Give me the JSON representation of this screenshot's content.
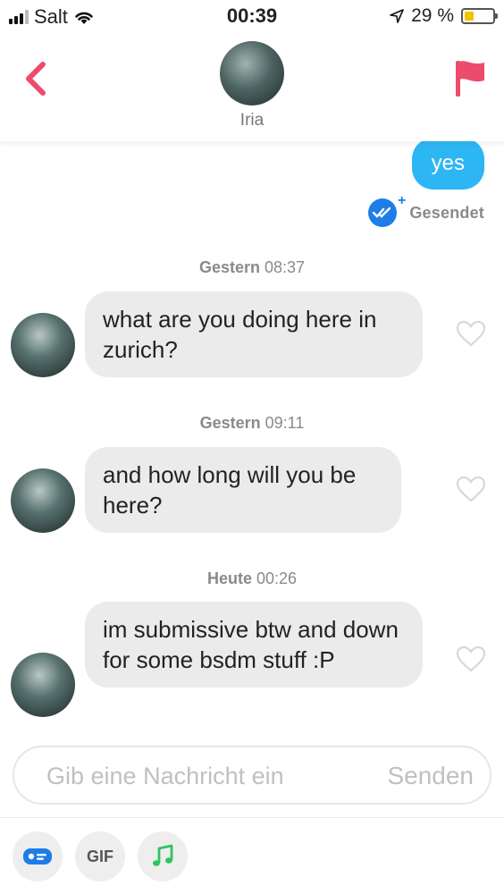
{
  "status_bar": {
    "carrier": "Salt",
    "time": "00:39",
    "battery": "29 %",
    "battery_level": 0.29
  },
  "header": {
    "name": "Iria",
    "back_icon": "chevron-left-icon",
    "report_icon": "flag-icon"
  },
  "colors": {
    "accent": "#ec4b6b",
    "outgoing_bubble": "#2db6f4",
    "incoming_bubble": "#ebebeb",
    "sent_check": "#1e7de6"
  },
  "messages": {
    "outgoing": {
      "text": "yes",
      "status": "Gesendet"
    },
    "incoming": [
      {
        "day": "Gestern",
        "time": "08:37",
        "text": "what are you doing here in zurich?"
      },
      {
        "day": "Gestern",
        "time": "09:11",
        "text": "and how long will you be here?"
      },
      {
        "day": "Heute",
        "time": "00:26",
        "text": "im submissive btw and down for some bsdm stuff :P"
      }
    ]
  },
  "composer": {
    "placeholder": "Gib eine Nachricht ein",
    "value": "",
    "send_label": "Senden"
  },
  "toolbar": {
    "gif_label": "GIF",
    "items": [
      "contact-card-icon",
      "gif-icon",
      "music-note-icon"
    ]
  }
}
